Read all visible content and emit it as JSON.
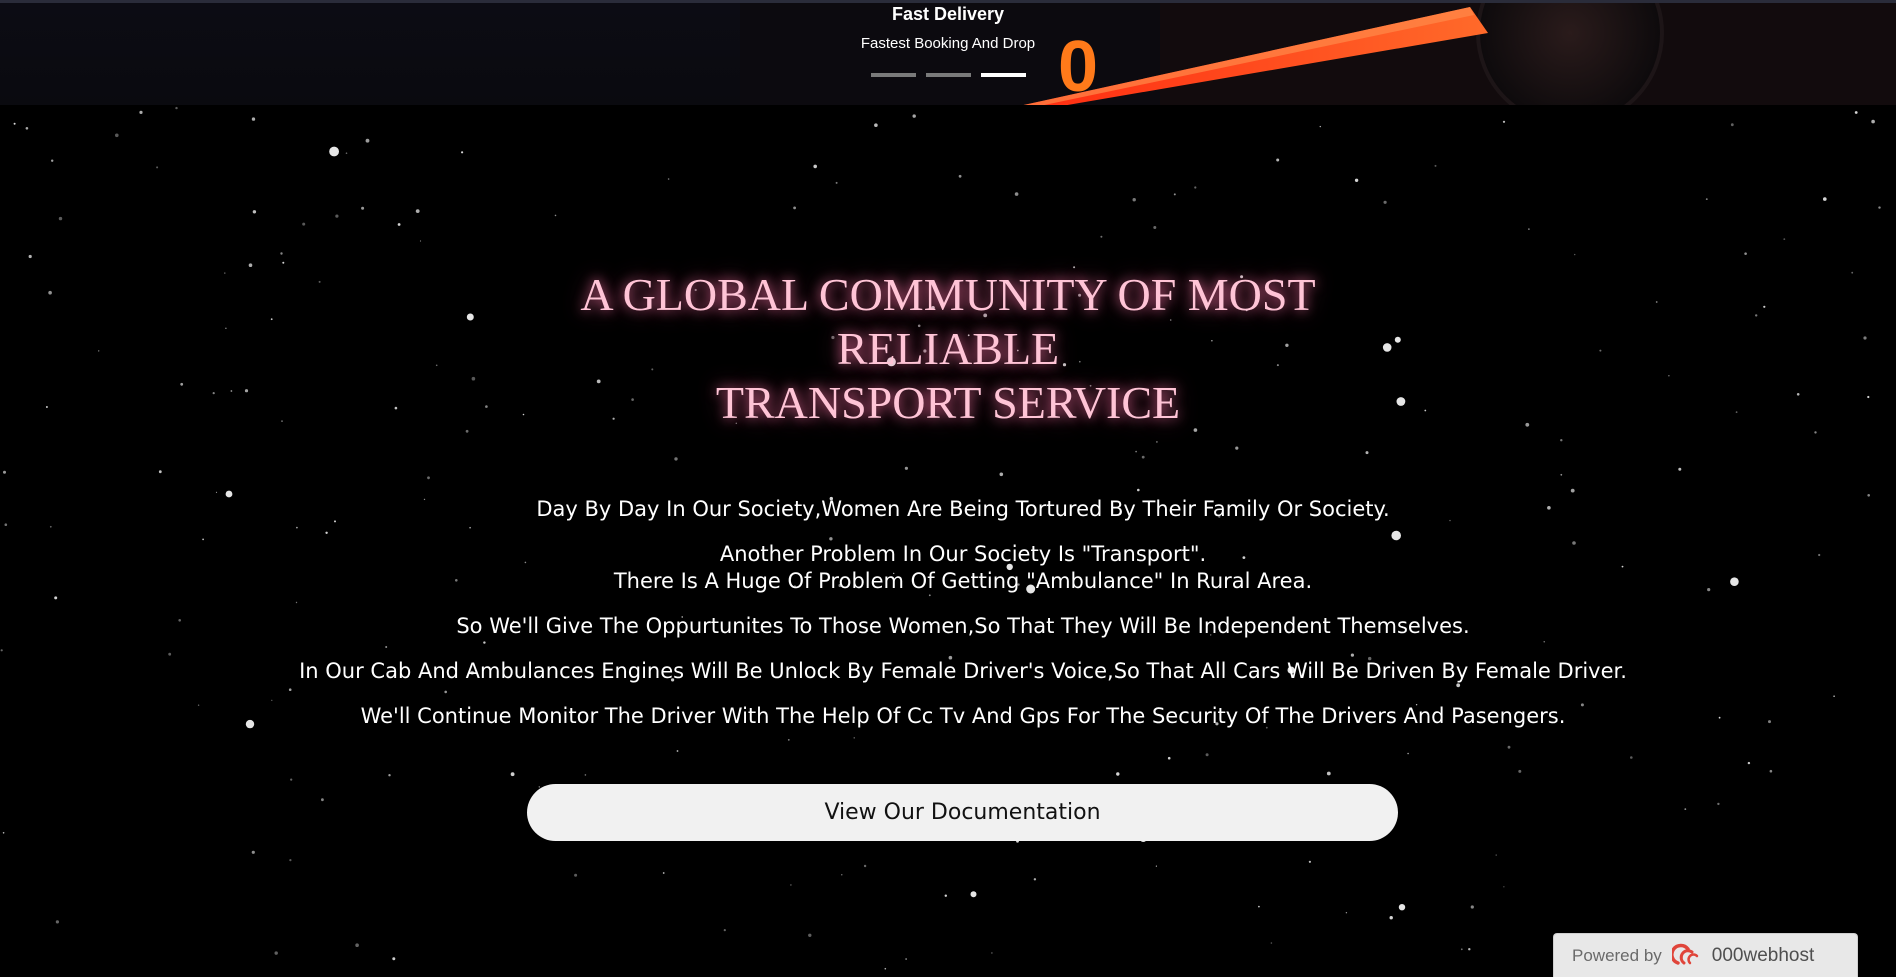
{
  "carousel": {
    "title": "Fast Delivery",
    "subtitle": "Fastest Booking And Drop",
    "indicators": [
      {
        "label": "slide-1",
        "active": false
      },
      {
        "label": "slide-2",
        "active": false
      },
      {
        "label": "slide-3",
        "active": true
      }
    ],
    "speedometer_digit": "0"
  },
  "hero": {
    "heading_lines": [
      "A GLOBAL COMMUNITY OF MOST",
      "RELIABLE",
      "TRANSPORT SERVICE"
    ],
    "paragraphs": [
      "Day By Day In Our Society,Women Are Being Tortured By Their Family Or Society.",
      "Another Problem In Our Society Is \"Transport\".",
      "There Is A Huge Of Problem Of Getting \"Ambulance\" In Rural Area.",
      "So We'll Give The Oppurtunites To Those Women,So That They Will Be Independent Themselves.",
      "In Our Cab And Ambulances Engines Will Be Unlock By Female Driver's Voice,So That All Cars Will Be Driven By Female Driver.",
      "We'll Continue Monitor The Driver With The Help Of Cc Tv And Gps For The Security Of The Drivers And Pasengers."
    ],
    "button_label": "View Our Documentation"
  },
  "badge": {
    "prefix": "Powered by",
    "brand": "000webhost"
  },
  "colors": {
    "background": "#000000",
    "heading": "#ffc4d6",
    "heading_glow": "#ff78aa",
    "button_bg": "#f1f1f1",
    "speedometer_orange": "#ff6a1a"
  }
}
